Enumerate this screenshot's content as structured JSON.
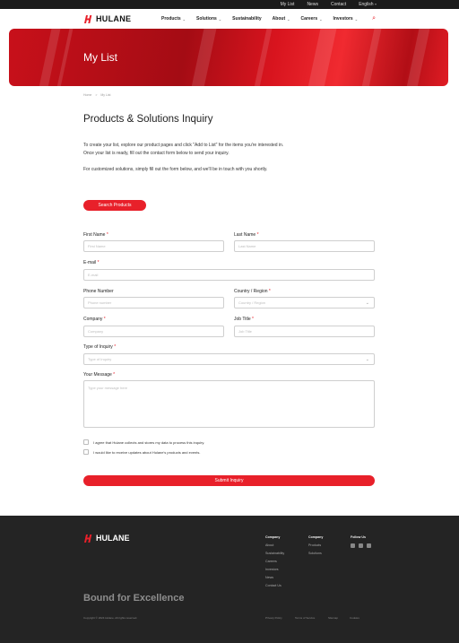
{
  "topbar": {
    "links": [
      "My List",
      "News",
      "Contact",
      "English"
    ]
  },
  "brand": {
    "name": "HULANE",
    "color": "#e8202a"
  },
  "nav": {
    "items": [
      "Products",
      "Solutions",
      "Sustainability",
      "About",
      "Careers",
      "Investors"
    ]
  },
  "hero": {
    "title": "My List"
  },
  "breadcrumb": {
    "home": "Home",
    "sep": ">",
    "current": "My List"
  },
  "page": {
    "title": "Products & Solutions Inquiry",
    "intro1": "To create your list, explore our product pages and click \"Add to List\" for the items you're interested in. Once your list is ready, fill out the contact form below to send your inquiry.",
    "intro2": "For customized solutions, simply fill out the form below, and we'll be in touch with you shortly.",
    "search_button": "Search Products"
  },
  "form": {
    "first_name": {
      "label": "First Name",
      "placeholder": "First Name"
    },
    "last_name": {
      "label": "Last Name",
      "placeholder": "Last Name"
    },
    "email": {
      "label": "E-mail",
      "placeholder": "E-mail"
    },
    "phone": {
      "label": "Phone Number",
      "placeholder": "Phone number"
    },
    "country": {
      "label": "Country / Region",
      "placeholder": "Country / Region"
    },
    "company": {
      "label": "Company",
      "placeholder": "Company"
    },
    "job": {
      "label": "Job Title",
      "placeholder": "Job Title"
    },
    "inquiry": {
      "label": "Type of Inquiry",
      "placeholder": "Type of Inquiry"
    },
    "message": {
      "label": "Your Message",
      "placeholder": "Type your message here"
    },
    "consent1": "I agree that Hulane collects and stores my data to process this inquiry.",
    "consent2": "I would like to receive updates about Hulane's products and events.",
    "submit": "Submit Inquiry",
    "required_mark": "*"
  },
  "footer": {
    "col1": {
      "heading": "Company",
      "links": [
        "About",
        "Sustainability",
        "Careers",
        "Investors",
        "News",
        "Contact Us"
      ]
    },
    "col2": {
      "heading": "Company",
      "links": [
        "Products",
        "Solutions"
      ]
    },
    "col3": {
      "heading": "Follow Us",
      "icons": [
        "linkedin-icon",
        "wechat-icon",
        "youtube-icon"
      ]
    },
    "tagline": "Bound for Excellence",
    "copyright": "Copyright © 2024 Hulane. All rights reserved.",
    "legal": [
      "Privacy Policy",
      "Terms of Service",
      "Sitemap",
      "Cookies"
    ]
  }
}
